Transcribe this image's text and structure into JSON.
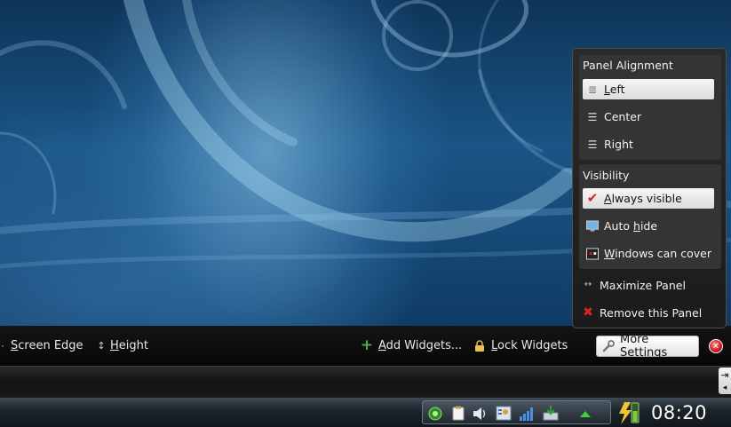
{
  "colors": {
    "accent_green": "#3fb43f",
    "close_red": "#d21414",
    "check_red": "#e02020"
  },
  "config_bar": {
    "screen_edge": {
      "mnemonic": "S",
      "rest": "creen Edge",
      "icon": "move-arrows-icon"
    },
    "height": {
      "mnemonic": "H",
      "rest": "eight",
      "icon": "vertical-resize-icon"
    },
    "add_widgets": {
      "prefix": "",
      "mnemonic": "A",
      "rest": "dd Widgets...",
      "icon": "plus-icon"
    },
    "lock_widgets": {
      "mnemonic": "L",
      "rest": "ock Widgets",
      "icon": "lock-icon"
    },
    "more_settings": {
      "mnemonic": "M",
      "rest": "ore Settings",
      "icon": "wrench-icon"
    },
    "close": {
      "icon": "close-icon",
      "glyph": "✕"
    }
  },
  "popup": {
    "alignment": {
      "title": "Panel Alignment",
      "options": [
        {
          "mnemonic": "L",
          "rest": "eft",
          "icon": "align-left-icon",
          "selected": true
        },
        {
          "mnemonic": "",
          "rest": "Center",
          "icon": "align-center-icon",
          "selected": false
        },
        {
          "mnemonic": "",
          "rest": "Right",
          "icon": "align-right-icon",
          "selected": false
        }
      ]
    },
    "visibility": {
      "title": "Visibility",
      "options": [
        {
          "mnemonic": "A",
          "rest": "lways visible",
          "icon": "checkmark-icon",
          "selected": true
        },
        {
          "prefix": "Auto ",
          "mnemonic": "h",
          "rest": "ide",
          "icon": "monitor-icon",
          "selected": false
        },
        {
          "mnemonic": "W",
          "rest": "indows can cover",
          "icon": "windows-cover-icon",
          "selected": false
        }
      ]
    },
    "maximize": {
      "mnemonic": "M",
      "rest": "aximize Panel",
      "icon": "expand-arrows-icon"
    },
    "remove": {
      "mnemonic": "R",
      "rest": "emove this Panel",
      "icon": "remove-icon"
    }
  },
  "taskbar": {
    "clock": "08:20",
    "tray_icons": [
      "network-icon",
      "clipboard-icon",
      "volume-icon",
      "user-switch-icon",
      "signal-bars-icon",
      "update-icon",
      "expand-tray-icon"
    ],
    "battery_icon": "battery-icon"
  }
}
